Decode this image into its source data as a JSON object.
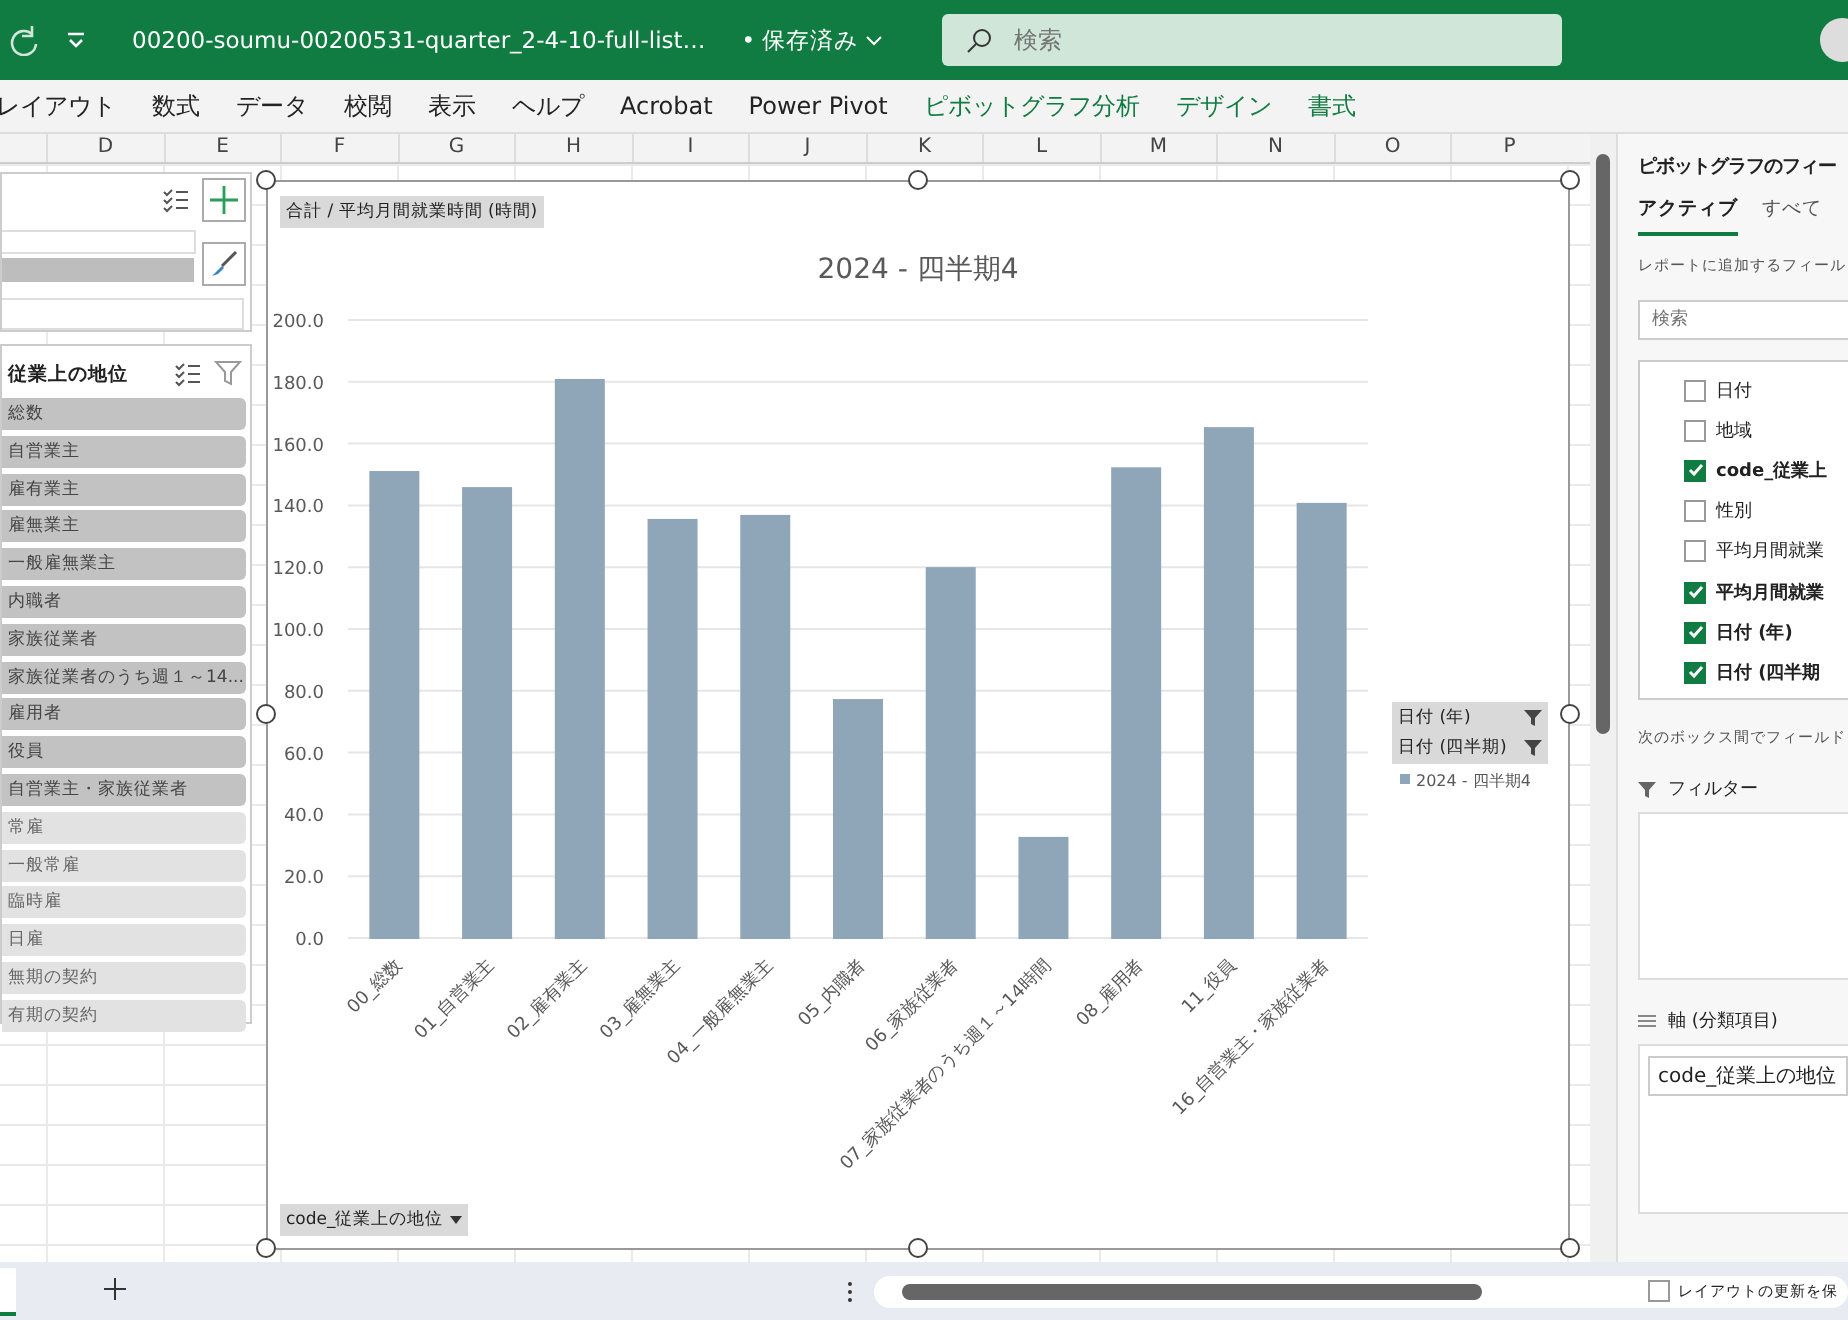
{
  "title_bar": {
    "file_name": "00200-soumu-00200531-quarter_2-4-10-full-list…",
    "save_status": "• 保存済み",
    "search_placeholder": "検索"
  },
  "ribbon_tabs": [
    {
      "label": "レイアウト",
      "contextual": false
    },
    {
      "label": "数式",
      "contextual": false
    },
    {
      "label": "データ",
      "contextual": false
    },
    {
      "label": "校閲",
      "contextual": false
    },
    {
      "label": "表示",
      "contextual": false
    },
    {
      "label": "ヘルプ",
      "contextual": false
    },
    {
      "label": "Acrobat",
      "contextual": false
    },
    {
      "label": "Power Pivot",
      "contextual": false
    },
    {
      "label": "ピボットグラフ分析",
      "contextual": true
    },
    {
      "label": "デザイン",
      "contextual": true
    },
    {
      "label": "書式",
      "contextual": true
    }
  ],
  "column_headers": [
    "D",
    "E",
    "F",
    "G",
    "H",
    "I",
    "J",
    "K",
    "L",
    "M",
    "N",
    "O",
    "P"
  ],
  "left_slicer": {
    "header": "従業上の地位",
    "items": [
      {
        "label": "総数",
        "selected": true
      },
      {
        "label": "自営業主",
        "selected": true
      },
      {
        "label": "雇有業主",
        "selected": true
      },
      {
        "label": "雇無業主",
        "selected": true
      },
      {
        "label": "一般雇無業主",
        "selected": true
      },
      {
        "label": "内職者",
        "selected": true
      },
      {
        "label": "家族従業者",
        "selected": true
      },
      {
        "label": "家族従業者のうち週１～14...",
        "selected": true
      },
      {
        "label": "雇用者",
        "selected": true
      },
      {
        "label": "役員",
        "selected": true
      },
      {
        "label": "自営業主・家族従業者",
        "selected": true
      },
      {
        "label": "常雇",
        "selected": false
      },
      {
        "label": "一般常雇",
        "selected": false
      },
      {
        "label": "臨時雇",
        "selected": false
      },
      {
        "label": "日雇",
        "selected": false
      },
      {
        "label": "無期の契約",
        "selected": false
      },
      {
        "label": "有期の契約",
        "selected": false
      }
    ]
  },
  "chart": {
    "value_field_button": "合計 / 平均月間就業時間 (時間)",
    "axis_field_button": "code_従業上の地位",
    "legend_field_buttons": [
      "日付 (年)",
      "日付 (四半期)"
    ],
    "chart_data": {
      "type": "bar",
      "title": "2024 - 四半期4",
      "categories": [
        "00_総数",
        "01_自営業主",
        "02_雇有業主",
        "03_雇無業主",
        "04_一般雇無業主",
        "05_内職者",
        "06_家族従業者",
        "07_家族従業者のうち週１～14時間",
        "08_雇用者",
        "11_役員",
        "16_自営業主・家族従業者"
      ],
      "series": [
        {
          "name": "2024 - 四半期4",
          "color": "#8fa5b8",
          "values": [
            150.8,
            145.6,
            180.6,
            135.3,
            136.6,
            77.0,
            119.7,
            32.4,
            152.0,
            165.0,
            140.5
          ]
        }
      ],
      "ylim": [
        0,
        200
      ],
      "grid": true,
      "yticks": [
        {
          "value": 0,
          "label": "0.0"
        },
        {
          "value": 20,
          "label": "20.0"
        },
        {
          "value": 40,
          "label": "40.0"
        },
        {
          "value": 60,
          "label": "60.0"
        },
        {
          "value": 80,
          "label": "80.0"
        },
        {
          "value": 100,
          "label": "100.0"
        },
        {
          "value": 120,
          "label": "120.0"
        },
        {
          "value": 140,
          "label": "140.0"
        },
        {
          "value": 160,
          "label": "160.0"
        },
        {
          "value": 180,
          "label": "180.0"
        },
        {
          "value": 200,
          "label": "200.0"
        }
      ]
    }
  },
  "field_pane": {
    "title": "ピボットグラフのフィー",
    "tabs": [
      {
        "label": "アクティブ",
        "selected": true
      },
      {
        "label": "すべて",
        "selected": false
      }
    ],
    "hint": "レポートに追加するフィール",
    "search_placeholder": "検索",
    "fields": [
      {
        "label": "日付",
        "checked": false
      },
      {
        "label": "地域",
        "checked": false
      },
      {
        "label": "code_従業上",
        "checked": true
      },
      {
        "label": "性別",
        "checked": false
      },
      {
        "label": "平均月間就業",
        "checked": false
      },
      {
        "label": "平均月間就業",
        "checked": true
      },
      {
        "label": "日付 (年)",
        "checked": true
      },
      {
        "label": "日付 (四半期",
        "checked": true
      }
    ],
    "areas_hint": "次のボックス間でフィールド",
    "filter_label": "フィルター",
    "axis_label": "軸 (分類項目)",
    "axis_fields": [
      "code_従業上の地位"
    ],
    "defer_update": {
      "label": "レイアウトの更新を保",
      "checked": false
    }
  }
}
